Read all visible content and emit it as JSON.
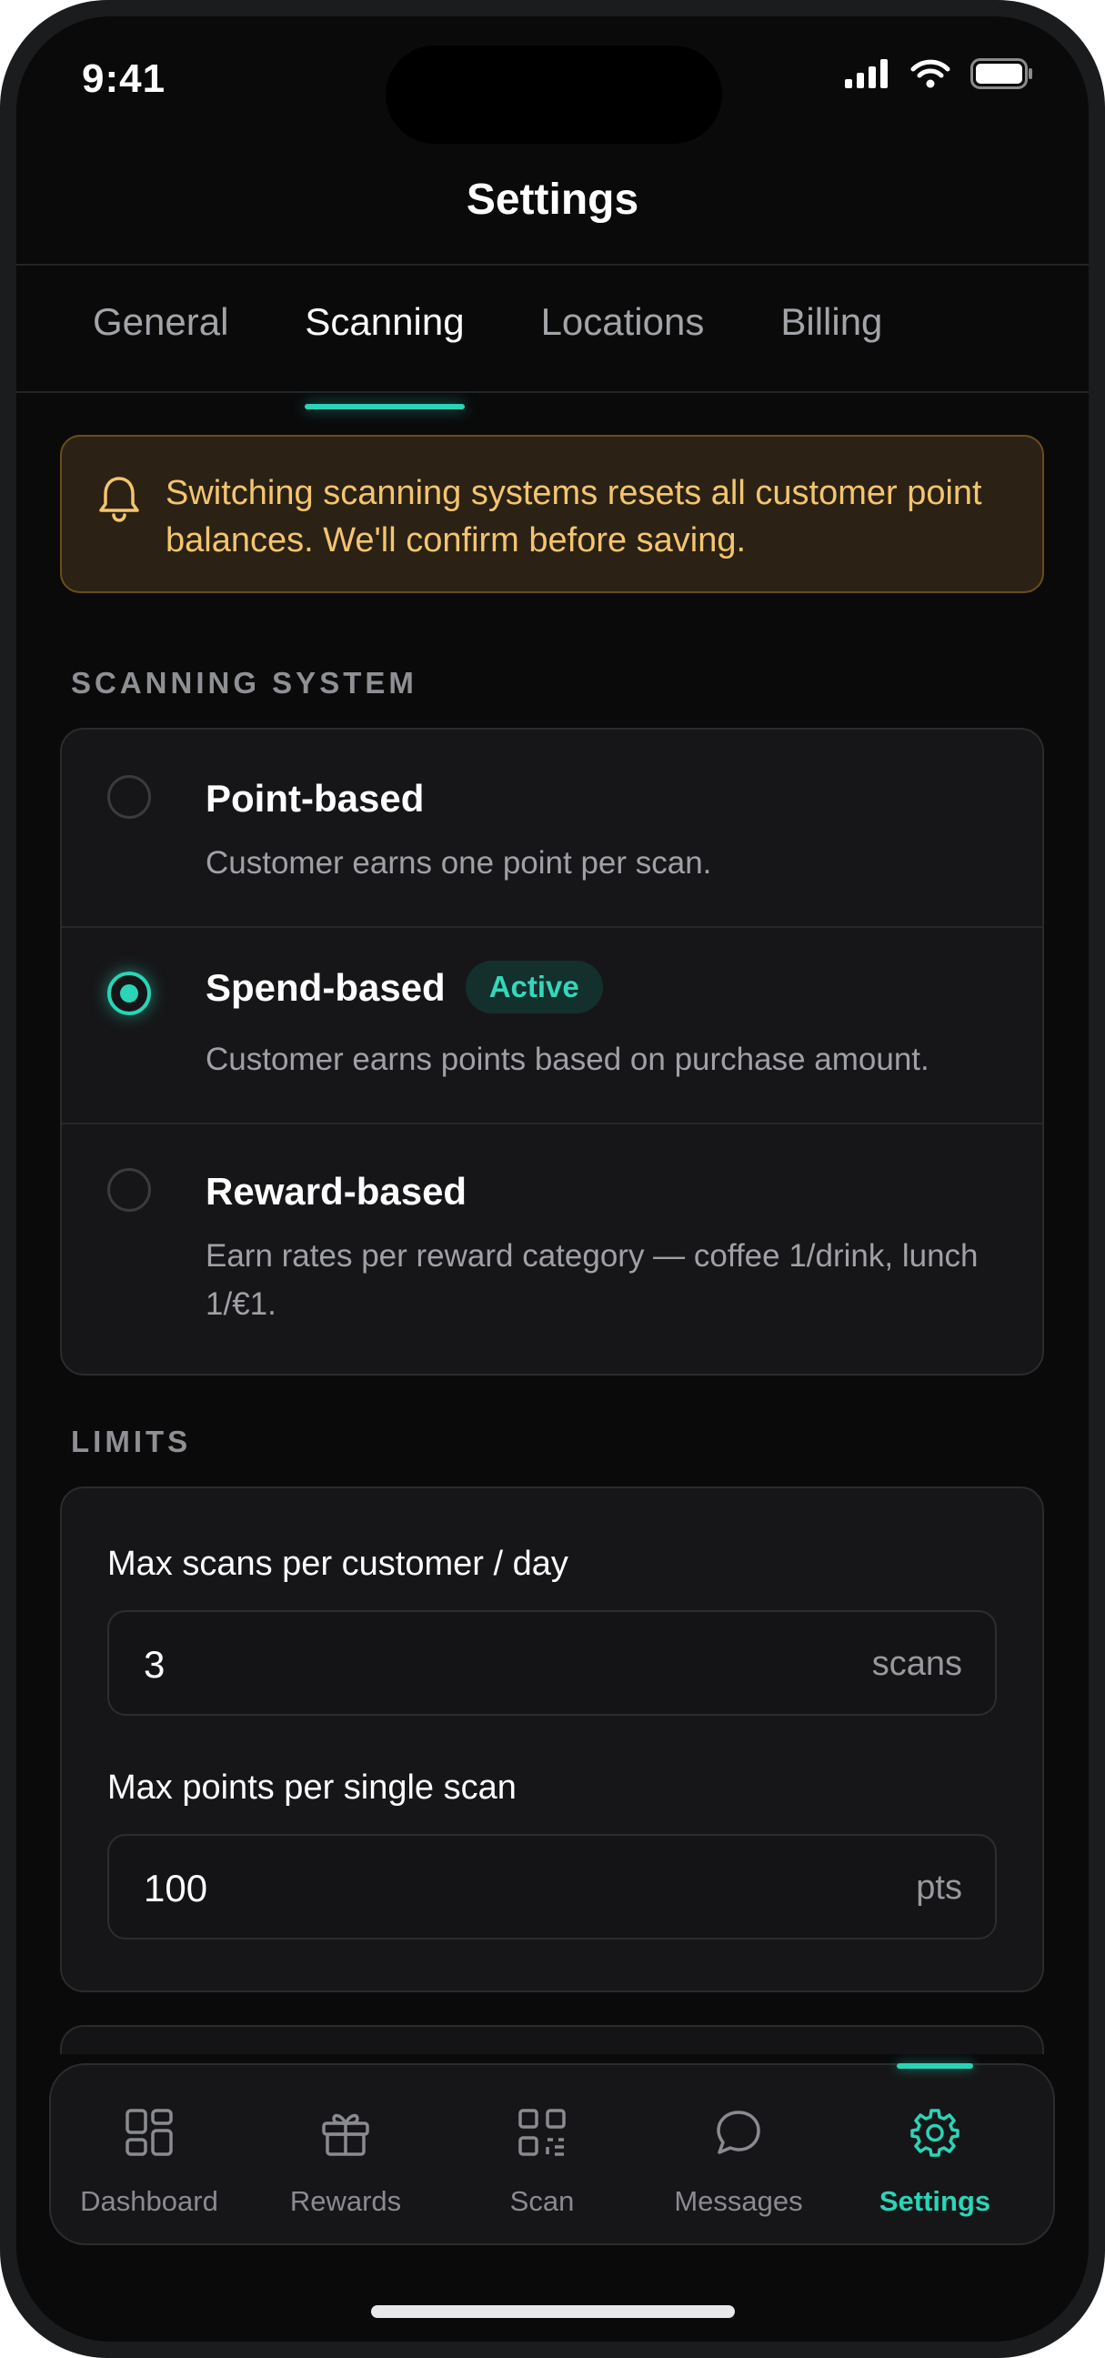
{
  "status_bar": {
    "time": "9:41"
  },
  "header": {
    "title": "Settings"
  },
  "tabs": [
    {
      "label": "General"
    },
    {
      "label": "Scanning",
      "active": true
    },
    {
      "label": "Locations"
    },
    {
      "label": "Billing"
    }
  ],
  "warning": {
    "icon": "bell-icon",
    "text": "Switching scanning systems resets all customer point balances. We'll confirm before saving."
  },
  "scanning_system": {
    "section_label": "SCANNING SYSTEM",
    "options": [
      {
        "title": "Point-based",
        "description": "Customer earns one point per scan.",
        "selected": false
      },
      {
        "title": "Spend-based",
        "badge": "Active",
        "description": "Customer earns points based on purchase amount.",
        "selected": true
      },
      {
        "title": "Reward-based",
        "description": "Earn rates per reward category — coffee 1/drink, lunch 1/€1.",
        "selected": false
      }
    ]
  },
  "limits": {
    "section_label": "LIMITS",
    "max_scans": {
      "label": "Max scans per customer / day",
      "value": "3",
      "unit": "scans"
    },
    "max_points": {
      "label": "Max points per single scan",
      "value": "100",
      "unit": "pts"
    }
  },
  "bottom_nav": [
    {
      "label": "Dashboard",
      "icon": "dashboard-icon"
    },
    {
      "label": "Rewards",
      "icon": "gift-icon"
    },
    {
      "label": "Scan",
      "icon": "qr-code-icon"
    },
    {
      "label": "Messages",
      "icon": "chat-bubble-icon"
    },
    {
      "label": "Settings",
      "icon": "gear-icon",
      "active": true
    }
  ],
  "colors": {
    "accent": "#2bd4b6",
    "warning_text": "#f4c56e",
    "background": "#0a0a0b"
  }
}
